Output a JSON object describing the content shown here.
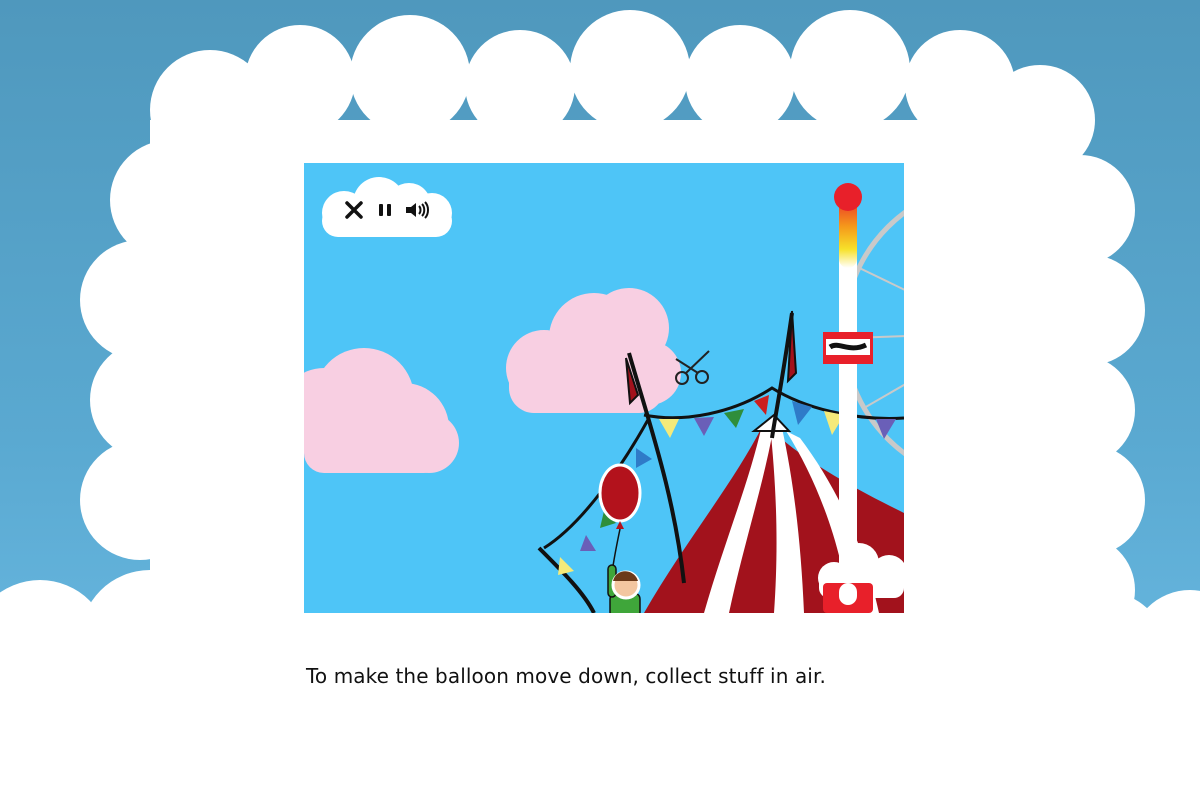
{
  "caption": "To make the balloon move down, collect stuff in air.",
  "hud": {
    "close_icon": "close-icon",
    "pause_icon": "pause-icon",
    "sound_icon": "speaker-icon"
  },
  "meter": {
    "level_fraction": 0.85,
    "colors": [
      "#e8202a",
      "#f59a1b",
      "#f7e12a",
      "#ffffff"
    ]
  },
  "colors": {
    "sky": "#4ec5f7",
    "outer_sky": "#5aa9d1",
    "cloud": "#ffffff",
    "pink_cloud": "#f8cfe2",
    "tent_red": "#a2121c",
    "balloon_red": "#b3121c",
    "kid_shirt": "#3fa63a"
  }
}
